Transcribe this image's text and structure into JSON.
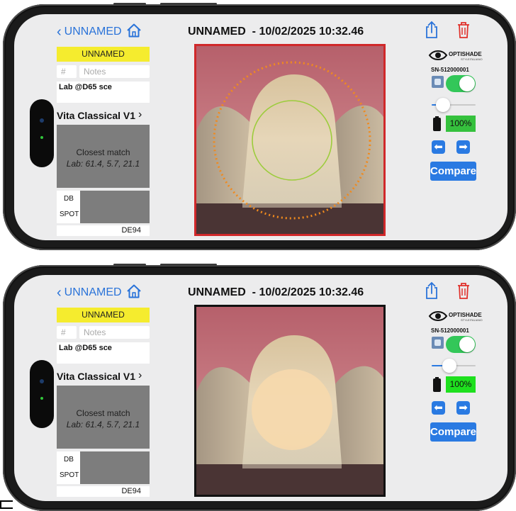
{
  "screens": [
    {
      "nav": {
        "back_label": "UNNAMED"
      },
      "title": "UNNAMED  - 10/02/2025 10:32.46",
      "sample_name": "UNNAMED",
      "number_placeholder": "#",
      "notes_placeholder": "Notes",
      "lab_mode": "Lab @D65 sce",
      "shade_guide": "Vita Classical V1",
      "match": {
        "label": "Closest match",
        "lab": "Lab: 61.4, 5.7, 21.1"
      },
      "swatch_labels": {
        "db": "DB",
        "spot": "SPOT"
      },
      "delta_formula": "DE94",
      "brand": "OPTISHADE",
      "brand_sub": "STYLEITALIANO",
      "serial": "SN-512000001",
      "toggle_on": true,
      "slider_level": 0.15,
      "battery": "100%",
      "battery_color": "#35c13d",
      "compare_label": "Compare",
      "photo_border": "#d0282a",
      "measurement_view": "rings"
    },
    {
      "nav": {
        "back_label": "UNNAMED"
      },
      "title": "UNNAMED  - 10/02/2025 10:32.46",
      "sample_name": "UNNAMED",
      "number_placeholder": "#",
      "notes_placeholder": "Notes",
      "lab_mode": "Lab @D65 sce",
      "shade_guide": "Vita Classical V1",
      "match": {
        "label": "Closest match",
        "lab": "Lab: 61.4, 5.7, 21.1"
      },
      "swatch_labels": {
        "db": "DB",
        "spot": "SPOT"
      },
      "delta_formula": "DE94",
      "brand": "OPTISHADE",
      "brand_sub": "STYLEITALIANO",
      "serial": "SN-512000001",
      "toggle_on": true,
      "slider_level": 0.35,
      "battery": "100%",
      "battery_color": "#1ee01e",
      "compare_label": "Compare",
      "photo_border": "#111111",
      "measurement_view": "filled"
    }
  ],
  "colors": {
    "accent": "#2a73d9",
    "button_blue": "#2a7ae2",
    "trash_red": "#e0312b",
    "name_yellow": "#f5ec2e",
    "swatch_gray": "#7d7d7d",
    "toggle_green": "#33c759"
  },
  "icons": [
    "chevron-left-icon",
    "home-icon",
    "share-icon",
    "trash-icon",
    "eye-logo-icon",
    "camera-icon",
    "battery-icon",
    "arrow-left-icon",
    "arrow-right-icon"
  ]
}
